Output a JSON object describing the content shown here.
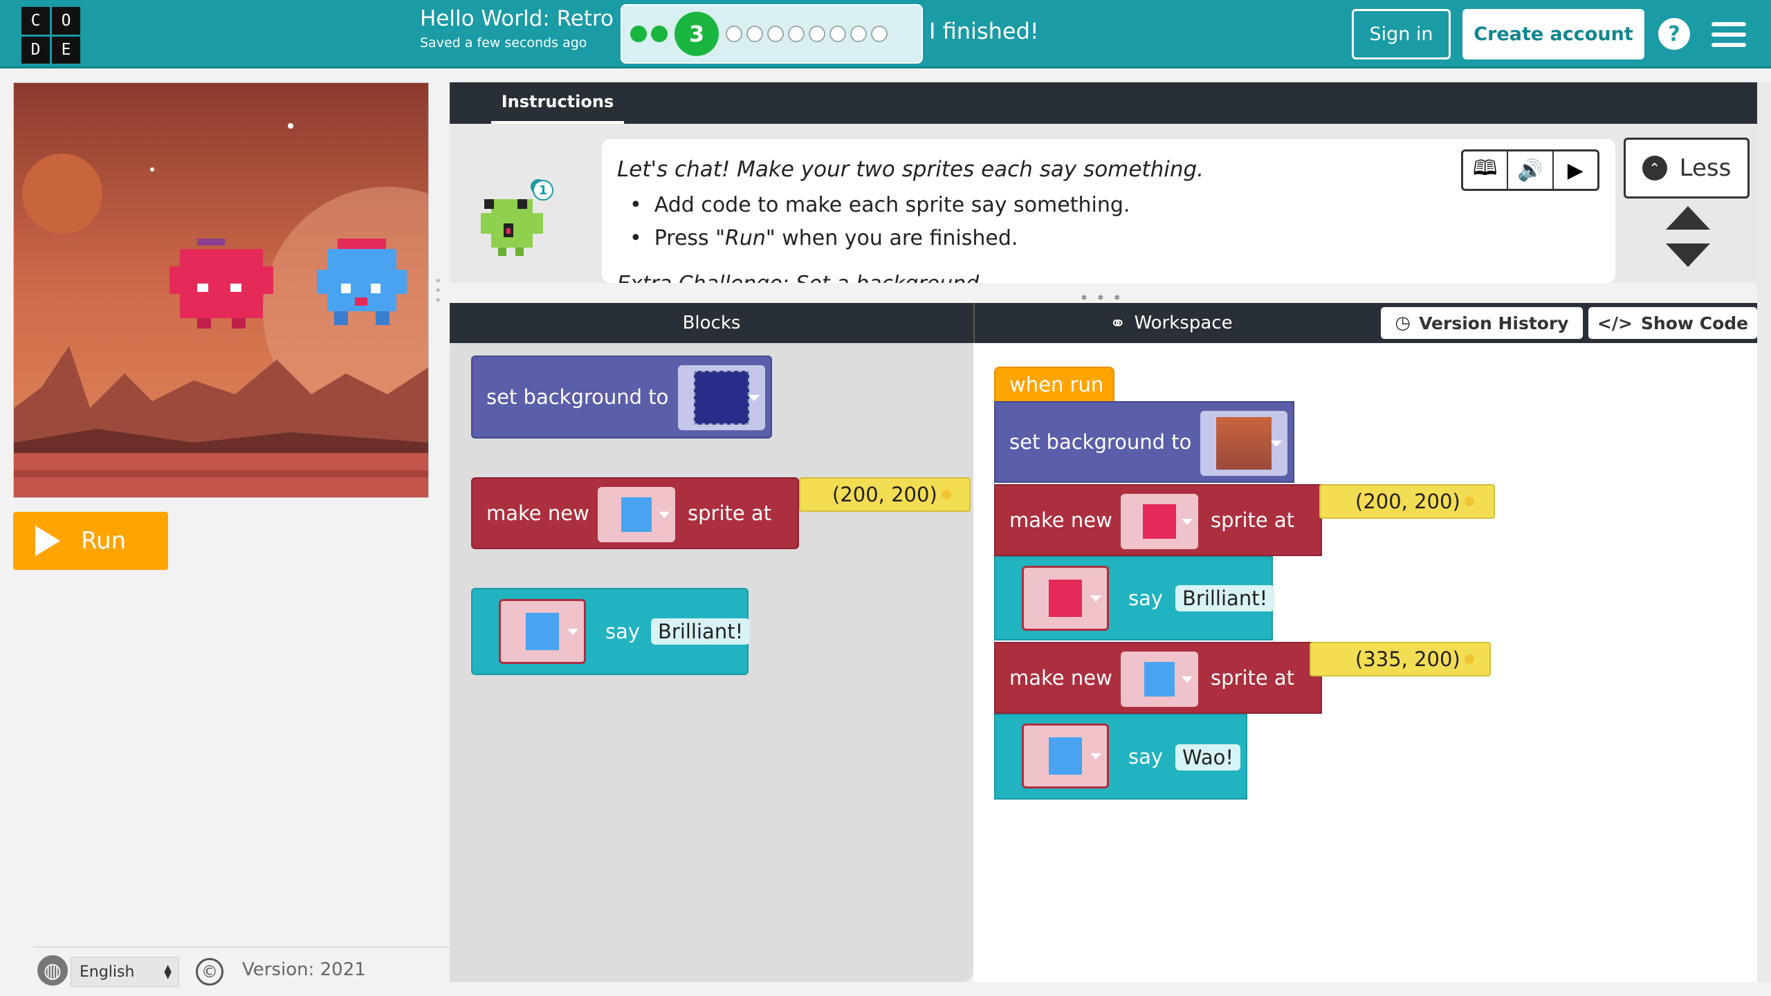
{
  "header": {
    "logo_letters": [
      "C",
      "O",
      "D",
      "E"
    ],
    "title": "Hello World: Retro",
    "saved": "Saved a few seconds ago",
    "progress": {
      "completed": 2,
      "current": "3",
      "remaining": 8
    },
    "finished": "I finished!",
    "sign_in": "Sign in",
    "create_account": "Create account",
    "help": "?"
  },
  "left": {
    "run": "Run",
    "language": "English",
    "copyright": "©",
    "version": "Version: 2021"
  },
  "instructions": {
    "tab": "Instructions",
    "badge": "1",
    "title": "Let's chat! Make your two sprites each say something.",
    "items": [
      "Add code to make each sprite say something.",
      "Press \"Run\" when you are finished."
    ],
    "item2_prefix": "Press ",
    "item2_run": "\"Run\"",
    "item2_suffix": " when you are finished.",
    "extra": "Extra Challenge: Set a background.",
    "less": "Less"
  },
  "panels": {
    "blocks": "Blocks",
    "workspace": "Workspace",
    "version_history": "Version History",
    "show_code": "Show Code"
  },
  "toolbox": {
    "set_background": "set background to",
    "make_new": "make new",
    "sprite_at": "sprite at",
    "coords": "(200, 200)",
    "say": "say",
    "say_text": "Brilliant!"
  },
  "workspace": {
    "when_run": "when run",
    "set_background": "set background to",
    "make_new_1": "make new",
    "sprite_at_1": "sprite at",
    "coords_1": "(200, 200)",
    "say_1": "say",
    "say_text_1": "Brilliant!",
    "make_new_2": "make new",
    "sprite_at_2": "sprite at",
    "coords_2": "(335, 200)",
    "say_2": "say",
    "say_text_2": "Wao!"
  },
  "colors": {
    "header": "#1a9ba5",
    "run": "#ffa400",
    "block_purple": "#5b5ea8",
    "block_red": "#ac2f3f",
    "block_teal": "#21b3c0",
    "block_orange": "#ffa400",
    "block_yellow": "#f3dd52"
  }
}
